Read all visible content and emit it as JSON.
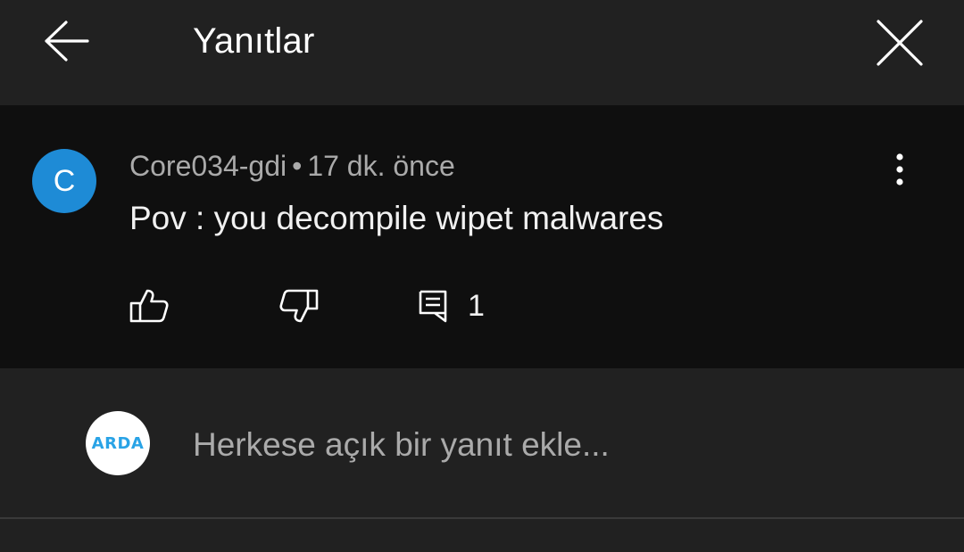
{
  "header": {
    "title": "Yanıtlar",
    "back_icon": "arrow-left-icon",
    "close_icon": "close-icon"
  },
  "comment": {
    "avatar_letter": "C",
    "avatar_color": "#1e8bd6",
    "author": "Core034-gdi",
    "separator": "•",
    "time": "17 dk. önce",
    "text": "Pov : you decompile wipet malwares",
    "reply_count": "1",
    "icons": [
      "thumbs-up-icon",
      "thumbs-down-icon",
      "comment-icon",
      "more-vert-icon"
    ]
  },
  "reply": {
    "user_avatar_text": "ARDA",
    "placeholder": "Herkese açık bir yanıt ekle..."
  },
  "colors": {
    "background": "#212121",
    "comment_background": "#0f0f0f",
    "secondary_text": "#aaaaaa"
  }
}
